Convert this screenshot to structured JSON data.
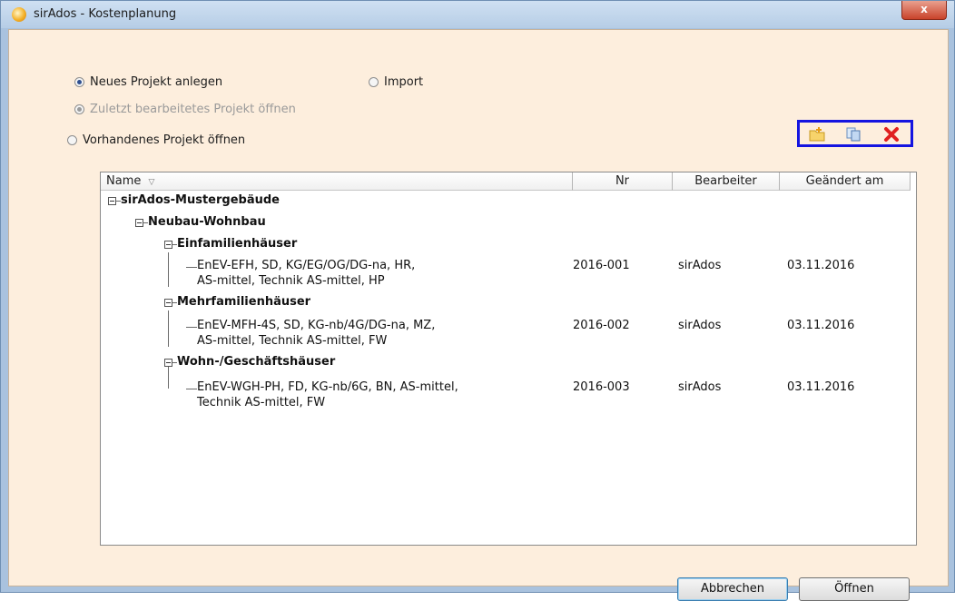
{
  "window": {
    "title": "sirAdos - Kostenplanung",
    "close_label": "x"
  },
  "options": {
    "new_project": "Neues Projekt anlegen",
    "import": "Import",
    "last_project": "Zuletzt bearbeitetes Projekt öffnen",
    "existing_project": "Vorhandenes Projekt öffnen",
    "selected": "new_project"
  },
  "toolbar": {
    "icons": [
      "new-folder-icon",
      "copy-icon",
      "delete-icon"
    ],
    "delete_color": "#e02020"
  },
  "tree": {
    "columns": [
      "Name",
      "Nr",
      "Bearbeiter",
      "Geändert am"
    ],
    "sort_glyph": "▽",
    "root": "sirAdos-Mustergebäude",
    "group": "Neubau-Wohnbau",
    "categories": [
      {
        "name": "Einfamilienhäuser",
        "project": {
          "line1": "EnEV-EFH, SD, KG/EG/OG/DG-na, HR,",
          "line2": "AS-mittel, Technik AS-mittel, HP",
          "nr": "2016-001",
          "editor": "sirAdos",
          "date": "03.11.2016"
        }
      },
      {
        "name": "Mehrfamilienhäuser",
        "project": {
          "line1": "EnEV-MFH-4S, SD, KG-nb/4G/DG-na, MZ,",
          "line2": "AS-mittel, Technik AS-mittel, FW",
          "nr": "2016-002",
          "editor": "sirAdos",
          "date": "03.11.2016"
        }
      },
      {
        "name": "Wohn-/Geschäftshäuser",
        "project": {
          "line1": "EnEV-WGH-PH, FD, KG-nb/6G, BN, AS-mittel,",
          "line2": "Technik AS-mittel, FW",
          "nr": "2016-003",
          "editor": "sirAdos",
          "date": "03.11.2016"
        }
      }
    ]
  },
  "buttons": {
    "cancel": "Abbrechen",
    "open": "Öffnen"
  }
}
